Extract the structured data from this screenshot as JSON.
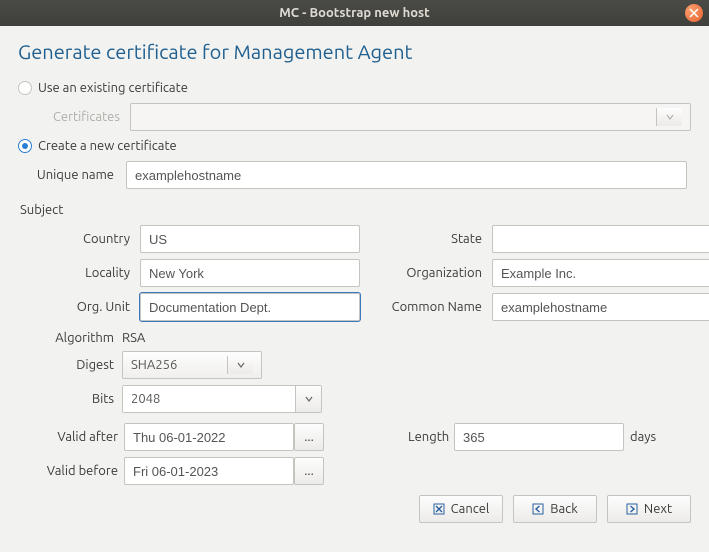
{
  "window": {
    "title": "MC - Bootstrap new host"
  },
  "heading": "Generate certificate for Management Agent",
  "options": {
    "use_existing": "Use an existing certificate",
    "create_new": "Create a new certificate"
  },
  "labels": {
    "certificates": "Certificates",
    "unique_name": "Unique name",
    "subject": "Subject",
    "country": "Country",
    "state": "State",
    "locality": "Locality",
    "organization": "Organization",
    "org_unit": "Org. Unit",
    "common_name": "Common Name",
    "algorithm": "Algorithm",
    "digest": "Digest",
    "bits": "Bits",
    "valid_after": "Valid after",
    "valid_before": "Valid before",
    "length": "Length",
    "days": "days",
    "ellipsis": "..."
  },
  "values": {
    "unique_name": "examplehostname",
    "country": "US",
    "state": "",
    "locality": "New York",
    "organization": "Example Inc.",
    "org_unit": "Documentation Dept.",
    "common_name": "examplehostname",
    "algorithm": "RSA",
    "digest": "SHA256",
    "bits": "2048",
    "valid_after": "Thu 06-01-2022",
    "valid_before": "Fri 06-01-2023",
    "length": "365"
  },
  "buttons": {
    "cancel": "Cancel",
    "back": "Back",
    "next": "Next"
  }
}
